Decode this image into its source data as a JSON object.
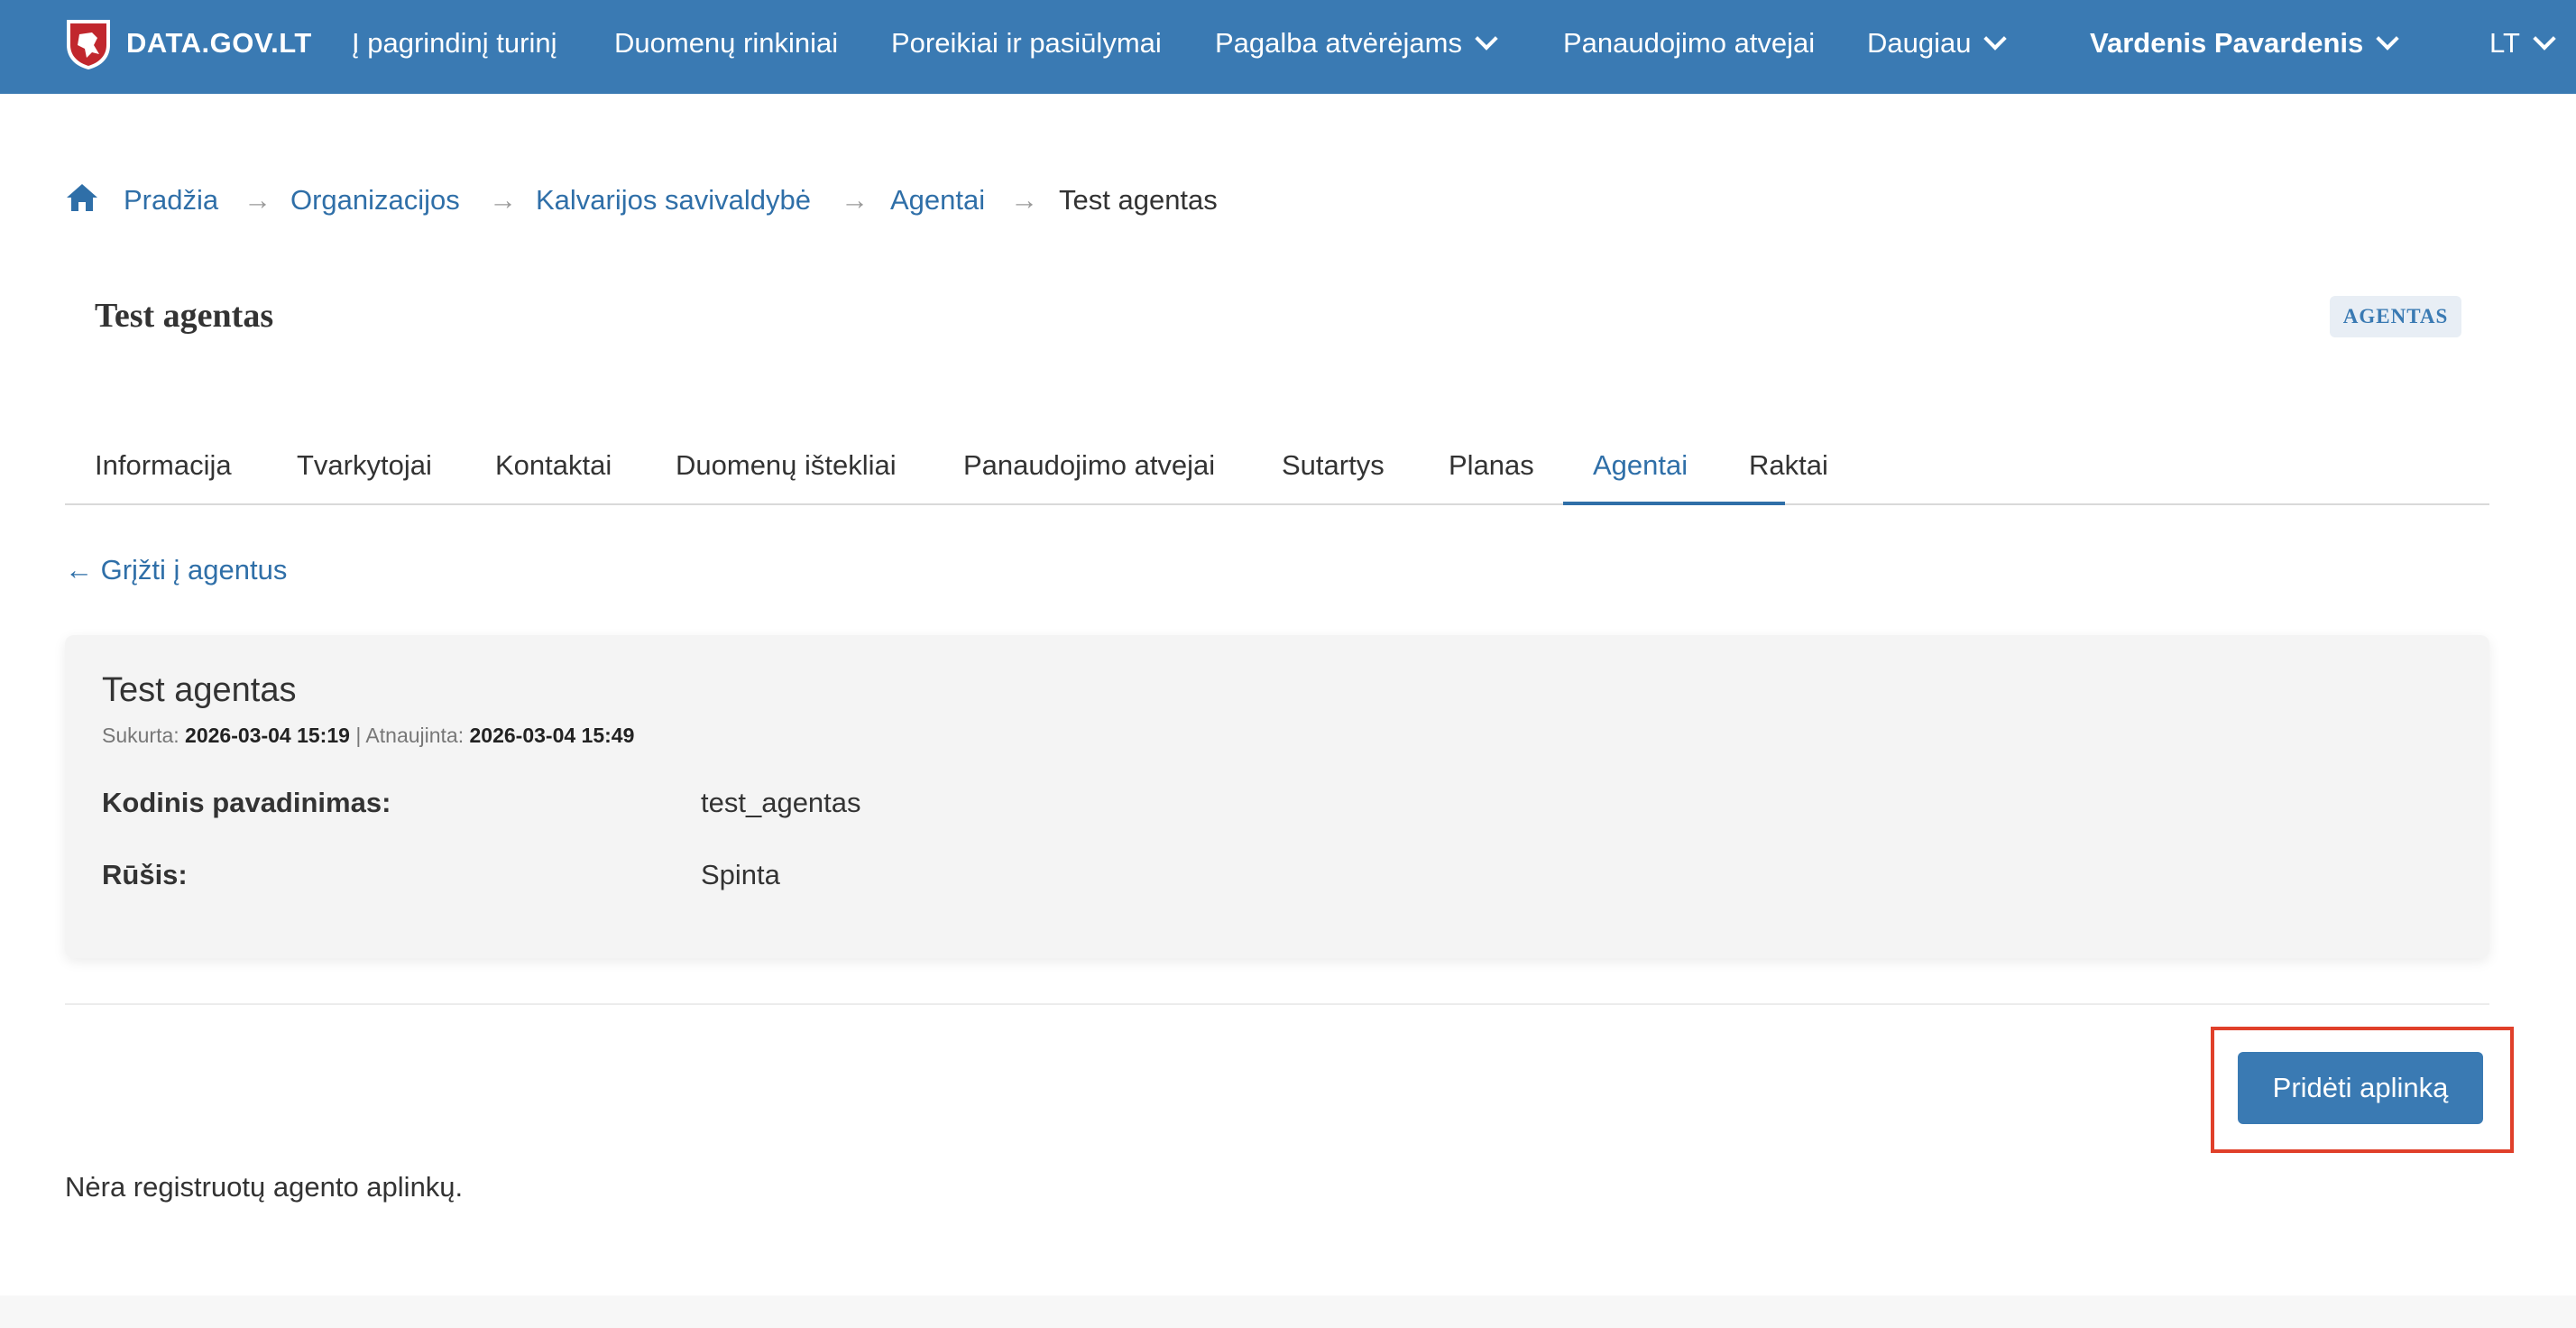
{
  "header": {
    "brand": "DATA.GOV.LT",
    "nav": [
      {
        "label": "Į pagrindinį turinį"
      },
      {
        "label": "Duomenų rinkiniai"
      },
      {
        "label": "Poreikiai ir pasiūlymai"
      },
      {
        "label": "Pagalba atvėrėjams"
      },
      {
        "label": "Panaudojimo atvejai"
      },
      {
        "label": "Daugiau"
      }
    ],
    "user_name": "Vardenis Pavardenis",
    "language": "LT",
    "icons": {
      "logo": "coat-of-arms-icon",
      "dropdown": "chevron-down-icon"
    },
    "colors": {
      "bar": "#3a7ab3"
    }
  },
  "breadcrumb": {
    "items": [
      "Pradžia",
      "Organizacijos",
      "Kalvarijos savivaldybė",
      "Agentai"
    ],
    "current": "Test agentas"
  },
  "page": {
    "title": "Test agentas",
    "badge": "AGENTAS"
  },
  "tabs": {
    "items": [
      "Informacija",
      "Tvarkytojai",
      "Kontaktai",
      "Duomenų ištekliai",
      "Panaudojimo atvejai",
      "Sutartys",
      "Planas",
      "Agentai",
      "Raktai"
    ],
    "active": "Agentai"
  },
  "back_link": "← Grįžti į agentus",
  "agent": {
    "name": "Test agentas",
    "created_label": "Sukurta:",
    "created": "2026-03-04 15:19",
    "separator": "|",
    "updated_label": "Atnaujinta:",
    "updated": "2026-03-04 15:49",
    "fields": [
      {
        "label": "Kodinis pavadinimas:",
        "value": "test_agentas"
      },
      {
        "label": "Rūšis:",
        "value": "Spinta"
      }
    ]
  },
  "actions": {
    "add_environment": "Pridėti aplinką",
    "highlight_color": "#e0402a"
  },
  "empty_message": "Nėra registruotų agento aplinkų."
}
